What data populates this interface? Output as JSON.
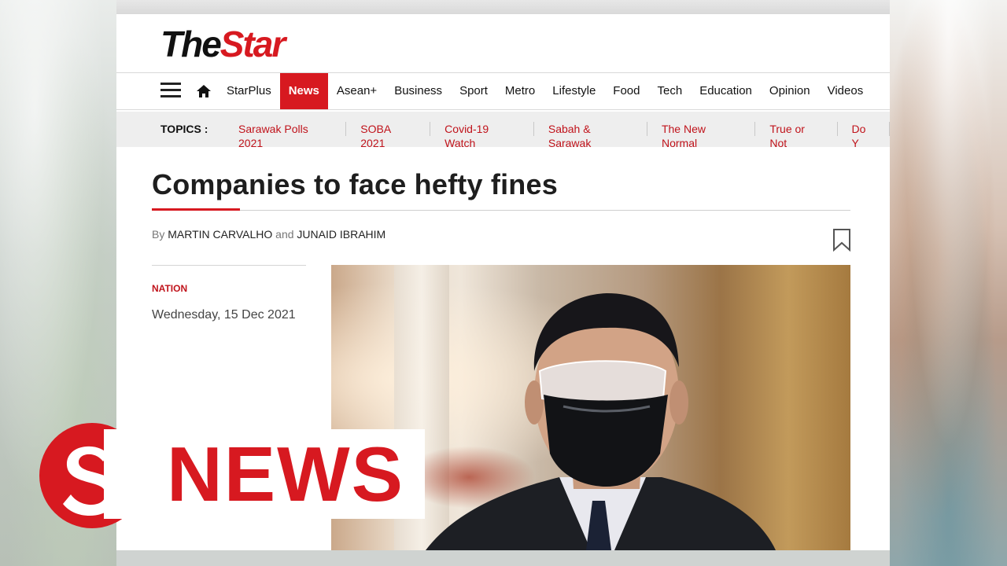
{
  "site": {
    "logo_part1": "The",
    "logo_part2": "Star"
  },
  "nav": {
    "items": [
      "StarPlus",
      "News",
      "Asean+",
      "Business",
      "Sport",
      "Metro",
      "Lifestyle",
      "Food",
      "Tech",
      "Education",
      "Opinion",
      "Videos"
    ],
    "active": "News"
  },
  "topics": {
    "label": "TOPICS :",
    "items": [
      "Sarawak Polls 2021",
      "SOBA 2021",
      "Covid-19 Watch",
      "Sabah & Sarawak",
      "The New Normal",
      "True or Not",
      "Do Y"
    ]
  },
  "article": {
    "headline": "Companies to face hefty fines",
    "by": "By",
    "author1": "MARTIN CARVALHO",
    "and": "and",
    "author2": "JUNAID IBRAHIM",
    "category": "NATION",
    "date": "Wednesday, 15 Dec 2021"
  },
  "overlay": {
    "logo_letter": "S",
    "label": "NEWS"
  },
  "colors": {
    "brand_red": "#d71920",
    "topic_red": "#c0131b"
  },
  "icons": [
    "hamburger-menu-icon",
    "home-icon",
    "bookmark-icon",
    "s-logo-icon"
  ]
}
